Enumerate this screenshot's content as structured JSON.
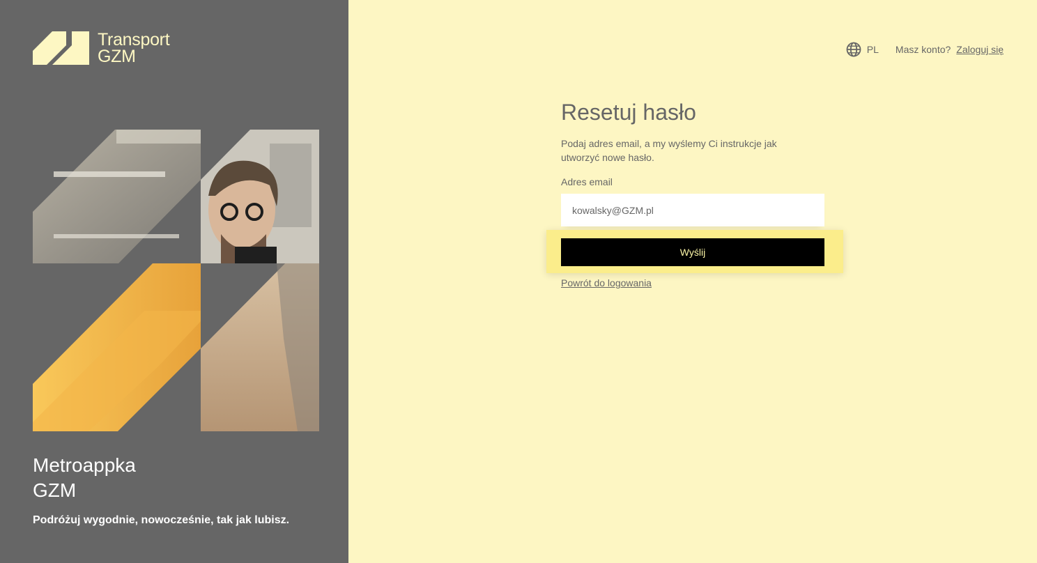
{
  "brand": {
    "line1": "Transport",
    "line2": "GZM",
    "logo_icon": "gzm-logo-icon"
  },
  "hero": {
    "image_subject": "man-with-glasses-near-tram-photo"
  },
  "left_panel": {
    "title_line1": "Metroappka",
    "title_line2": "GZM",
    "subtitle": "Podróżuj wygodnie, nowocześnie, tak jak lubisz."
  },
  "topbar": {
    "language_icon": "globe-icon",
    "language_code": "PL",
    "account_question": "Masz konto?",
    "login_link": "Zaloguj się"
  },
  "form": {
    "title": "Resetuj hasło",
    "description": "Podaj adres email, a my wyślemy Ci instrukcje jak utworzyć nowe hasło.",
    "email_label": "Adres email",
    "email_value": "kowalsky@GZM.pl",
    "submit_label": "Wyślij",
    "back_link": "Powrót do logowania"
  },
  "colors": {
    "left_bg": "#666666",
    "right_bg": "#fdf6c3",
    "accent_yellow": "#fbed8b",
    "button_bg": "#000000",
    "button_text": "#fdf7a8",
    "text_muted": "#666666"
  }
}
